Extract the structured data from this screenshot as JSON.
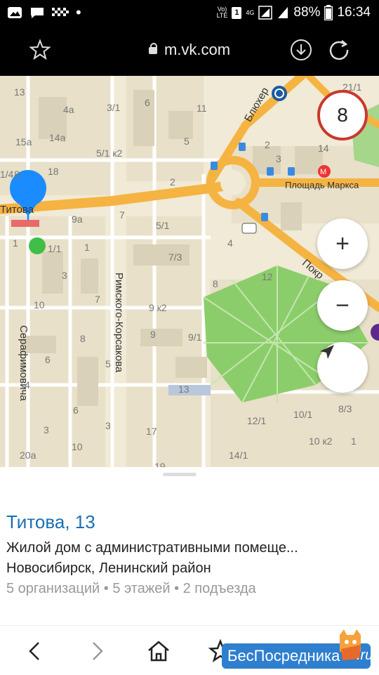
{
  "status_bar": {
    "volte_top": "Vo)",
    "volte_bottom": "LTE",
    "sim": "1",
    "net": "4G",
    "battery": "88%",
    "time": "16:34"
  },
  "browser": {
    "url": "m.vk.com"
  },
  "map": {
    "zoom_badge": "8",
    "streets": {
      "titova": "Титова",
      "blyukher": "Блюхер",
      "rimskogo": "Римского-Корсакова",
      "serafimovicha": "Серафимовича",
      "pokr": "Покр"
    },
    "metro": "Площадь Маркса",
    "buildings": [
      "13",
      "4а",
      "3/1",
      "6",
      "11",
      "21/1",
      "15а",
      "14а",
      "5/1 к2",
      "5",
      "14",
      "2",
      "3",
      "1/4",
      "8",
      "2",
      "18",
      "9а",
      "7",
      "5/1",
      "1",
      "1/1",
      "1",
      "4",
      "7/3",
      "3",
      "7",
      "10",
      "9 к2",
      "8",
      "9",
      "9/1",
      "8",
      "12",
      "6",
      "5",
      "13",
      "4",
      "6",
      "3",
      "3",
      "17",
      "12/1",
      "10/1",
      "8/3",
      "10",
      "10 к2",
      "1",
      "20а",
      "14/1",
      "19"
    ],
    "controls": {
      "zoom_in": "+",
      "zoom_out": "−"
    },
    "pin_color": "#1a8cff",
    "road_color": "#f5b342"
  },
  "card": {
    "title": "Титова, 13",
    "description": "Жилой дом с административными помеще...",
    "address": "Новосибирск, Ленинский район",
    "meta": "5 организаций • 5 этажей • 2 подъезда"
  },
  "watermark": {
    "text": "БесПосредника",
    "suffix": ".ru"
  }
}
